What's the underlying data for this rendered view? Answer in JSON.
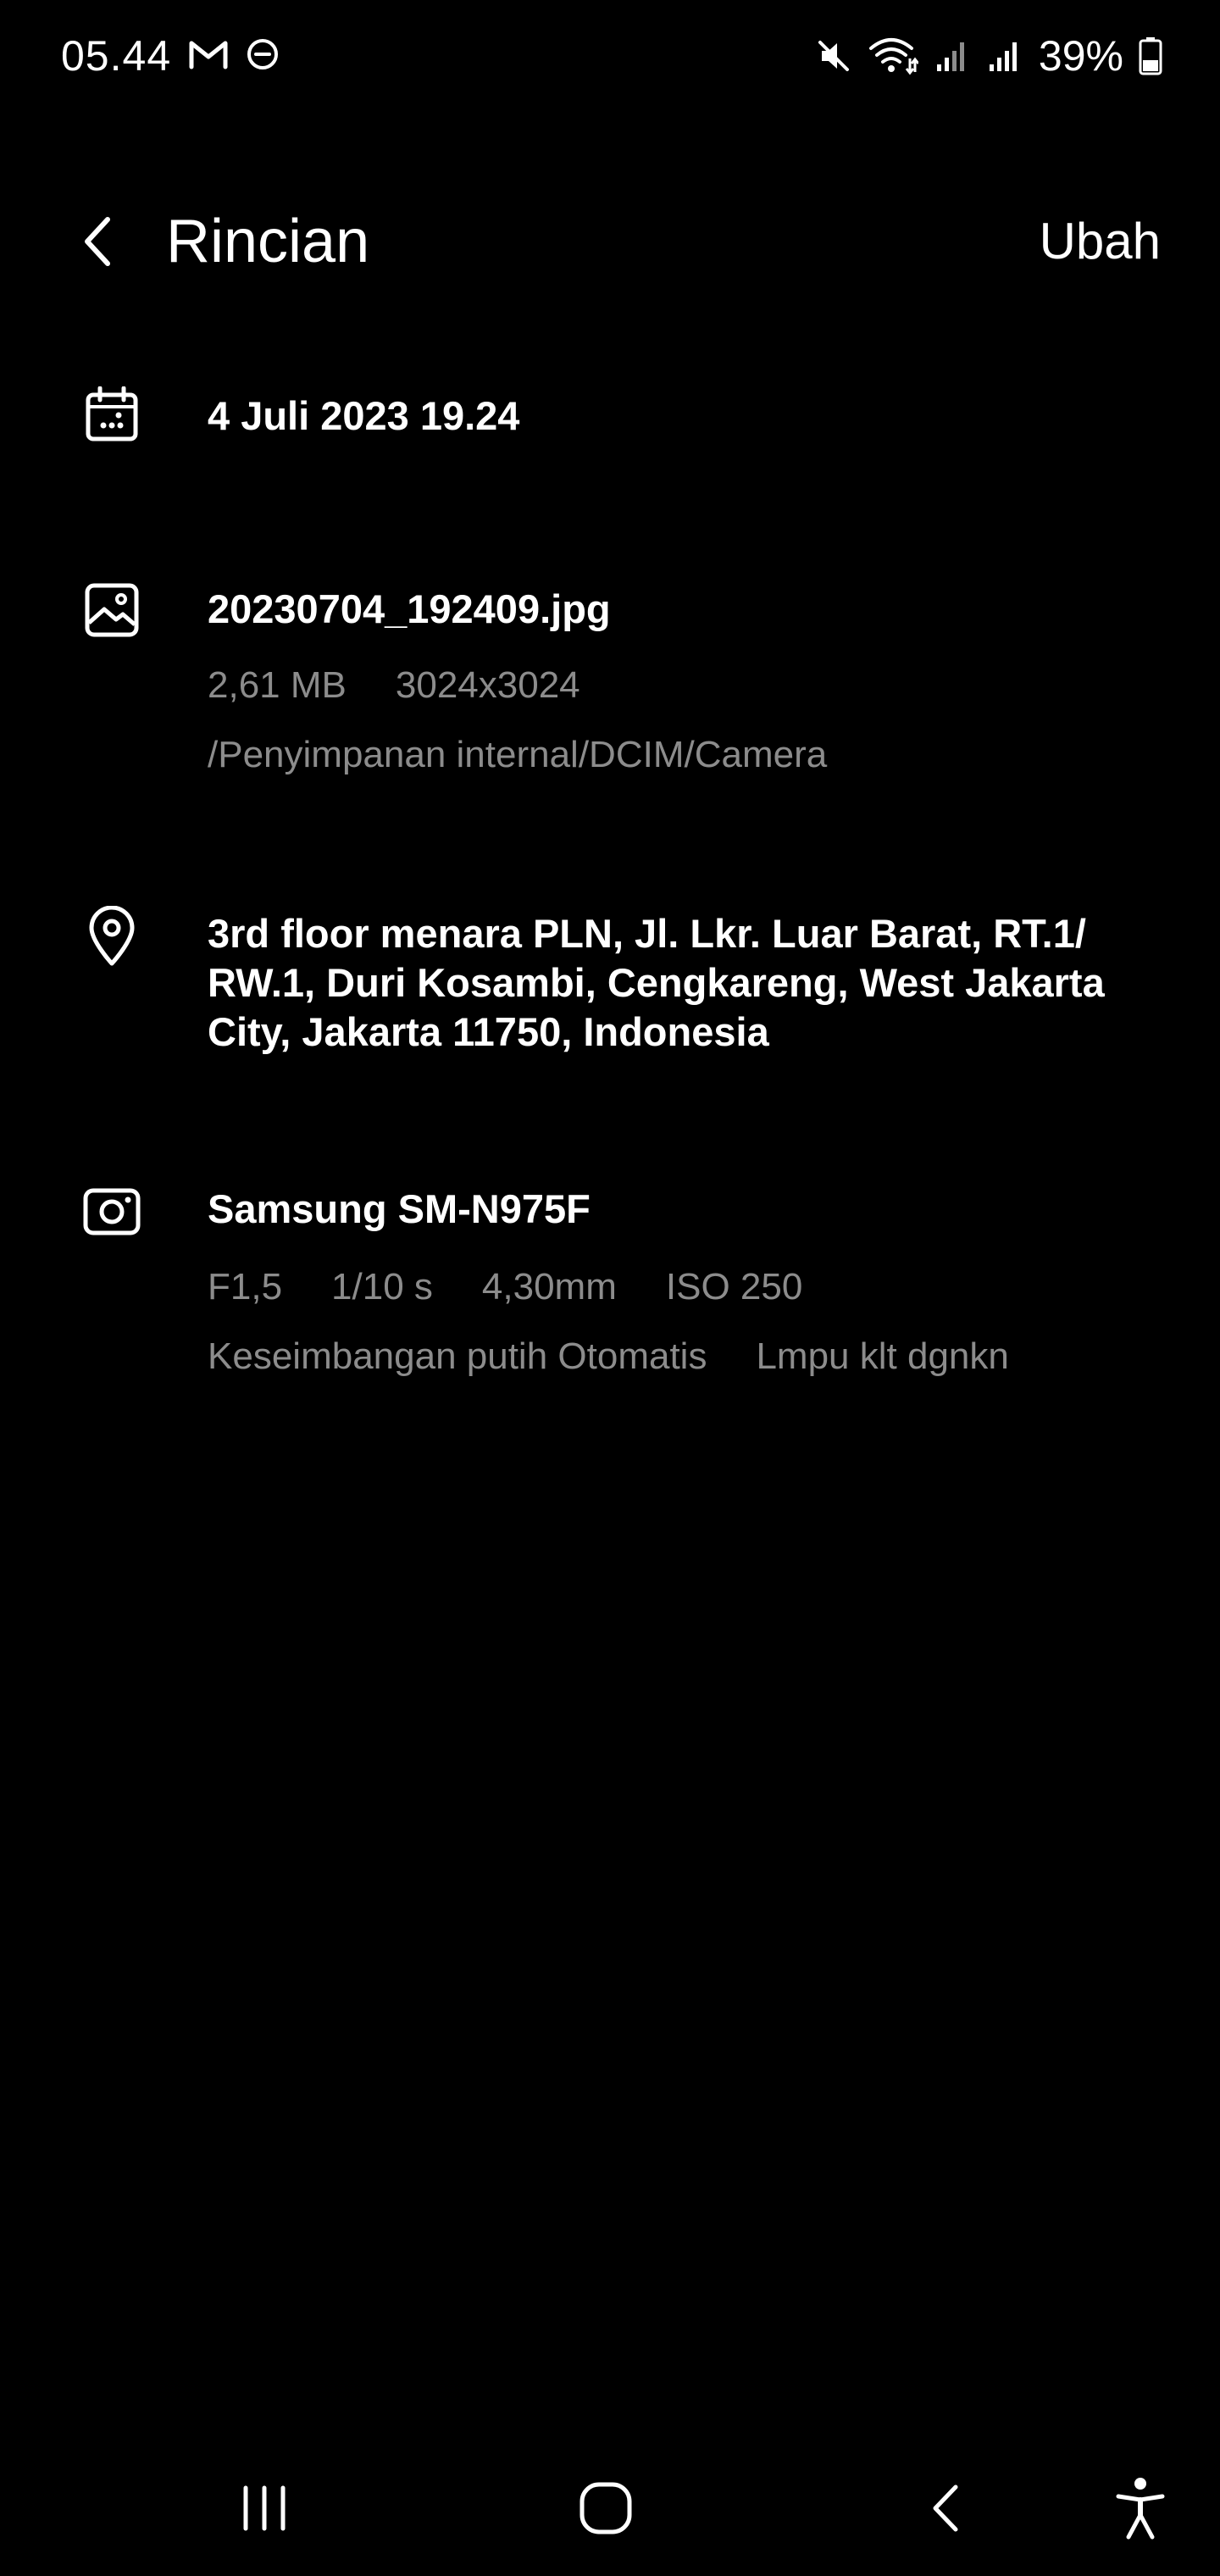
{
  "status_bar": {
    "time": "05.44",
    "battery_percent": "39%",
    "left_icons": [
      "gmail-icon",
      "do-not-disturb-icon"
    ],
    "right_icons": [
      "mute-icon",
      "wifi-icon",
      "signal-icon",
      "signal-icon",
      "battery-icon"
    ]
  },
  "header": {
    "title": "Rincian",
    "edit_label": "Ubah"
  },
  "date_section": {
    "icon": "calendar-icon",
    "datetime": "4 Juli 2023 19.24"
  },
  "file_section": {
    "icon": "image-icon",
    "filename": "20230704_192409.jpg",
    "size": "2,61 MB",
    "resolution": "3024x3024",
    "path": "/Penyimpanan internal/DCIM/Camera"
  },
  "location_section": {
    "icon": "location-pin-icon",
    "address_lines": [
      "3rd floor menara PLN, Jl. Lkr. Luar Barat, RT.1/",
      "RW.1, Duri Kosambi, Cengkareng, West Jakarta",
      "City, Jakarta 11750, Indonesia"
    ]
  },
  "camera_section": {
    "icon": "camera-icon",
    "model": "Samsung SM-N975F",
    "aperture": "F1,5",
    "shutter": "1/10 s",
    "focal_length": "4,30mm",
    "iso": "ISO 250",
    "white_balance": "Keseimbangan putih Otomatis",
    "flash": "Lmpu klt dgnkn"
  },
  "nav_bar": {
    "buttons": [
      "recent-apps-icon",
      "home-icon",
      "back-icon",
      "accessibility-icon"
    ]
  },
  "colors": {
    "background": "#000000",
    "primary_text": "#ffffff",
    "secondary_text": "#8c8c8c"
  }
}
